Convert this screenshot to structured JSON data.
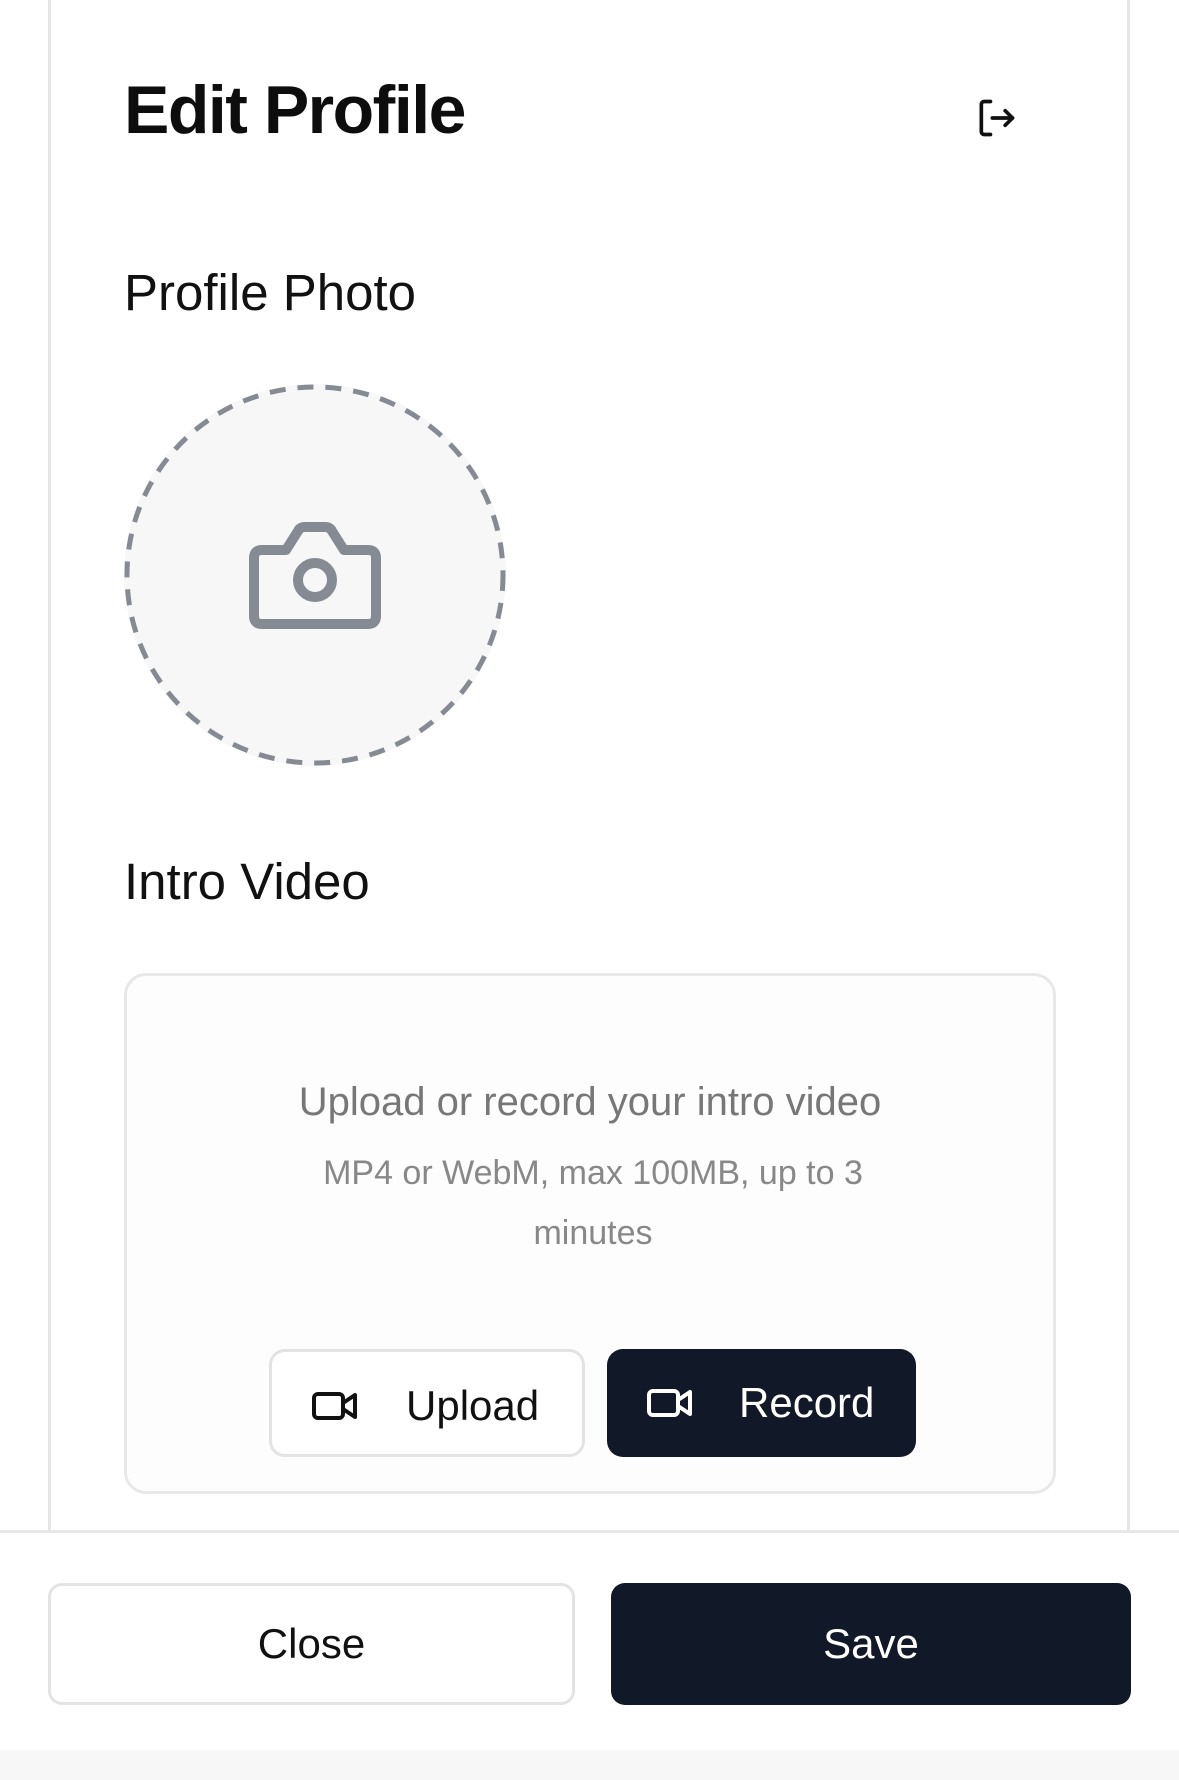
{
  "header": {
    "title": "Edit Profile",
    "logout_icon": "logout-icon"
  },
  "profile_photo": {
    "title": "Profile Photo",
    "placeholder_icon": "camera-icon"
  },
  "intro_video": {
    "title": "Intro Video",
    "hint": "Upload or record your intro video",
    "subhint": "MP4 or WebM, max 100MB, up to 3 minutes",
    "upload_label": "Upload",
    "upload_icon": "video-camera-icon",
    "record_label": "Record",
    "record_icon": "video-camera-icon"
  },
  "footer": {
    "close_label": "Close",
    "save_label": "Save"
  },
  "colors": {
    "primary_dark": "#111827",
    "border": "#e6e6e6",
    "muted_text": "#777777",
    "icon_gray": "#858a93"
  }
}
